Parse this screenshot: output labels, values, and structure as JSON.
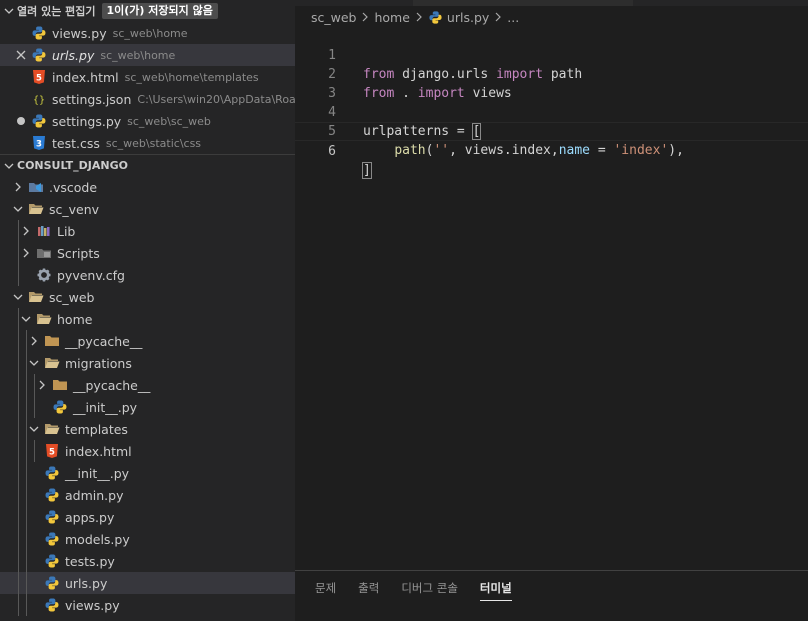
{
  "open_editors": {
    "title": "열려 있는 편집기",
    "unsaved_badge": "1이(가) 저장되지 않음",
    "items": [
      {
        "name": "views.py",
        "path": "sc_web\\home",
        "icon": "python-icon"
      },
      {
        "name": "urls.py",
        "path": "sc_web\\home",
        "icon": "python-icon"
      },
      {
        "name": "index.html",
        "path": "sc_web\\home\\templates",
        "icon": "html-icon"
      },
      {
        "name": "settings.json",
        "path": "C:\\Users\\win20\\AppData\\Roa...",
        "icon": "json-icon"
      },
      {
        "name": "settings.py",
        "path": "sc_web\\sc_web",
        "icon": "python-icon"
      },
      {
        "name": "test.css",
        "path": "sc_web\\static\\css",
        "icon": "css-icon"
      }
    ]
  },
  "explorer": {
    "title": "CONSULT_DJANGO",
    "items": [
      {
        "name": ".vscode"
      },
      {
        "name": "sc_venv"
      },
      {
        "name": "Lib"
      },
      {
        "name": "Scripts"
      },
      {
        "name": "pyvenv.cfg"
      },
      {
        "name": "sc_web"
      },
      {
        "name": "home"
      },
      {
        "name": "__pycache__"
      },
      {
        "name": "migrations"
      },
      {
        "name": "__pycache__"
      },
      {
        "name": "__init__.py"
      },
      {
        "name": "templates"
      },
      {
        "name": "index.html"
      },
      {
        "name": "__init__.py"
      },
      {
        "name": "admin.py"
      },
      {
        "name": "apps.py"
      },
      {
        "name": "models.py"
      },
      {
        "name": "tests.py"
      },
      {
        "name": "urls.py"
      },
      {
        "name": "views.py"
      }
    ]
  },
  "breadcrumb": [
    "sc_web",
    "home",
    "urls.py",
    "..."
  ],
  "code": {
    "line_numbers": [
      "1",
      "2",
      "3",
      "4",
      "5",
      "6"
    ],
    "l1": {
      "kw1": "from",
      "t1": " django.urls ",
      "kw2": "import",
      "t2": " path"
    },
    "l2": {
      "kw1": "from",
      "t1": " . ",
      "kw2": "import",
      "t2": " views"
    },
    "l4": {
      "t1": "urlpatterns = ",
      "br": "["
    },
    "l5": {
      "ind": "    ",
      "fn": "path",
      "t1": "(",
      "s1": "''",
      "t2": ", views.index,",
      "v1": "name",
      "t3": " = ",
      "s2": "'index'",
      "t4": "),"
    },
    "l6": {
      "br": "]"
    }
  },
  "panel": {
    "tabs": [
      "문제",
      "출력",
      "디버그 콘솔",
      "터미널"
    ],
    "active_tab": "터미널"
  },
  "colors": {
    "keyword": "#c586c0",
    "string": "#ce9178",
    "function": "#dcdcaa",
    "variable": "#9cdcfe",
    "sidebar_bg": "#252526",
    "editor_bg": "#1e1e1e"
  }
}
